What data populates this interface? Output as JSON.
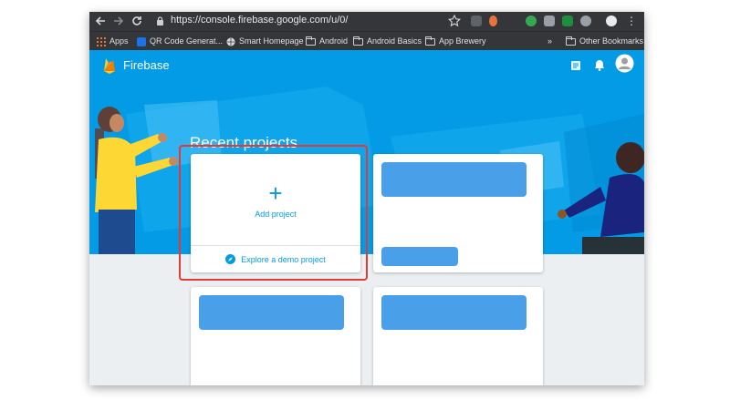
{
  "browser": {
    "url": "https://console.firebase.google.com/u/0/",
    "bookmarks": [
      {
        "label": "Apps",
        "icon": "apps-grid-icon"
      },
      {
        "label": "QR Code Generat...",
        "icon": "qr-code-icon"
      },
      {
        "label": "Smart Homepage",
        "icon": "globe-icon"
      },
      {
        "label": "Android",
        "icon": "folder-icon"
      },
      {
        "label": "Android Basics",
        "icon": "folder-icon"
      },
      {
        "label": "App Brewery",
        "icon": "folder-icon"
      },
      {
        "label": "Other Bookmarks",
        "icon": "folder-icon"
      }
    ],
    "overflow": "»"
  },
  "app": {
    "brand": "Firebase",
    "section_title": "Recent projects",
    "add_card": {
      "plus": "+",
      "label": "Add project",
      "explore_label": "Explore a demo project"
    }
  },
  "colors": {
    "hero": "#039be5",
    "accent": "#039be5",
    "placeholder_bar": "#4aa0e8",
    "highlight": "#e53935"
  }
}
